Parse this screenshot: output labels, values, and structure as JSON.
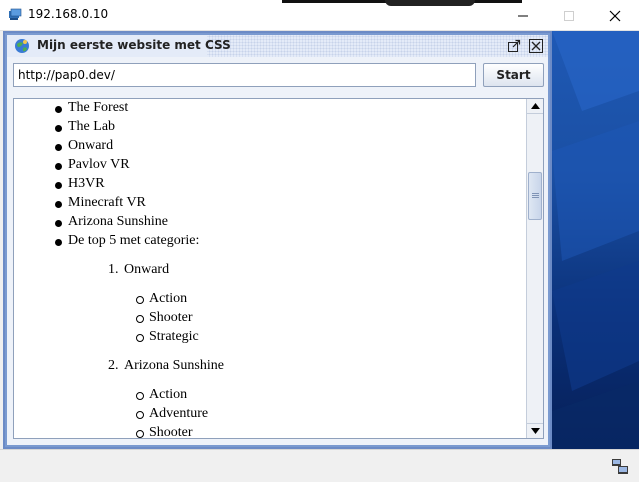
{
  "os_window": {
    "title": "192.168.0.10",
    "app_icon": "remote-desktop-icon",
    "controls": [
      "minimize-icon",
      "maximize-icon",
      "close-icon"
    ]
  },
  "internal_frame": {
    "title": "Mijn eerste website met CSS",
    "icon": "java-globe-icon",
    "controls": [
      "popout-icon",
      "close-icon"
    ]
  },
  "browser": {
    "url_value": "http://pap0.dev/",
    "start_label": "Start"
  },
  "content": {
    "bullets": [
      "The Forest",
      "The Lab",
      "Onward",
      "Pavlov VR",
      "H3VR",
      "Minecraft VR",
      "Arizona Sunshine",
      "De top 5 met categorie:"
    ],
    "top_list": [
      {
        "number": "1.",
        "title": "Onward",
        "categories": [
          "Action",
          "Shooter",
          "Strategic"
        ]
      },
      {
        "number": "2.",
        "title": "Arizona Sunshine",
        "categories": [
          "Action",
          "Adventure",
          "Shooter"
        ]
      }
    ]
  },
  "colors": {
    "frame_border": "#6c8bc6",
    "frame_body": "#eef2f9",
    "desktop_blue": "#1a4fa3"
  }
}
